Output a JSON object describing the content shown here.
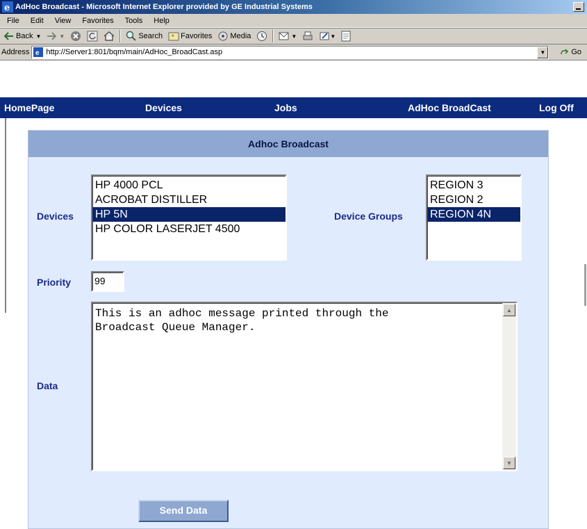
{
  "window": {
    "title": "AdHoc Broadcast - Microsoft Internet Explorer provided by GE Industrial Systems"
  },
  "menu": [
    "File",
    "Edit",
    "View",
    "Favorites",
    "Tools",
    "Help"
  ],
  "toolbar": {
    "back_label": "Back",
    "search_label": "Search",
    "favorites_label": "Favorites",
    "media_label": "Media"
  },
  "address": {
    "label": "Address",
    "url": "http://Server1:801/bqm/main/AdHoc_BroadCast.asp",
    "go_label": "Go"
  },
  "nav": {
    "items": [
      "HomePage",
      "Devices",
      "Jobs",
      "AdHoc BroadCast",
      "Log Off"
    ]
  },
  "panel": {
    "title": "Adhoc Broadcast"
  },
  "form": {
    "devices_label": "Devices",
    "devices_options": [
      "HP 4000 PCL",
      "ACROBAT DISTILLER",
      "HP 5N",
      "HP COLOR LASERJET 4500"
    ],
    "devices_selected": "HP 5N",
    "groups_label": "Device Groups",
    "groups_options": [
      "REGION 3",
      "REGION 2",
      "REGION 4N"
    ],
    "groups_selected": "REGION 4N",
    "priority_label": "Priority",
    "priority_value": "99",
    "data_label": "Data",
    "data_value": "This is an adhoc message printed through the\nBroadcast Queue Manager.",
    "send_label": "Send Data"
  },
  "colors": {
    "nav_bg": "#0c2b7e",
    "panel_bg": "#e0ebfd",
    "panel_header": "#8fa8d2",
    "label_text": "#1a2a8a",
    "selection": "#0a246a"
  }
}
